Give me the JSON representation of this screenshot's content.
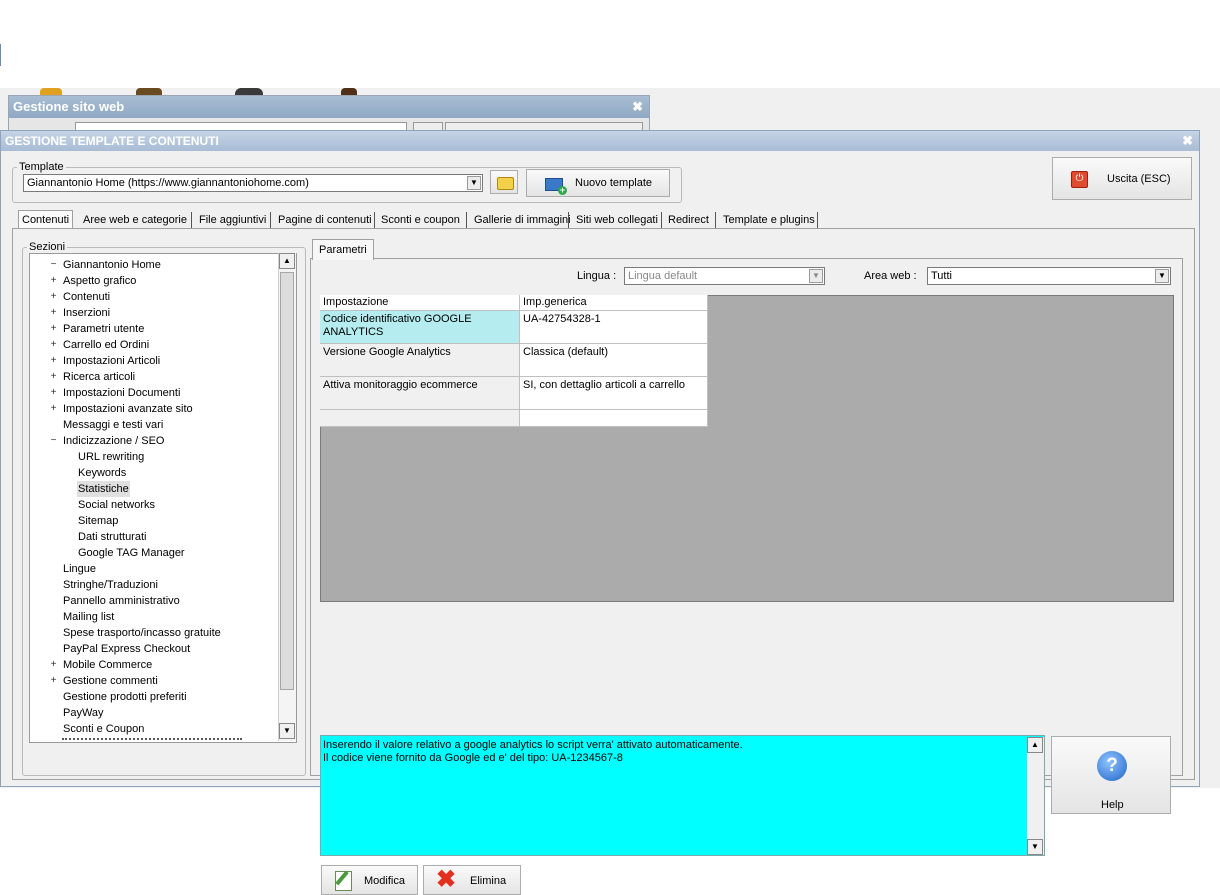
{
  "bg_window": {
    "title": "Gestione sito web",
    "close": "✖"
  },
  "main_window": {
    "title": "GESTIONE TEMPLATE E CONTENUTI",
    "close": "✖"
  },
  "template_group": {
    "legend": "Template",
    "selected": "Giannantonio Home (https://www.giannantoniohome.com)",
    "new_button": "Nuovo template"
  },
  "exit_button": "Uscita (ESC)",
  "tabs": [
    {
      "label": "Contenuti"
    },
    {
      "label": "Aree web e categorie"
    },
    {
      "label": "File aggiuntivi"
    },
    {
      "label": "Pagine di contenuti"
    },
    {
      "label": "Sconti e coupon"
    },
    {
      "label": "Gallerie di immagini"
    },
    {
      "label": "Siti web collegati"
    },
    {
      "label": "Redirect"
    },
    {
      "label": "Template e plugins"
    }
  ],
  "sections": {
    "legend": "Sezioni",
    "items": [
      {
        "label": "Giannantonio Home",
        "expander": "−"
      },
      {
        "label": "Aspetto grafico",
        "expander": "+"
      },
      {
        "label": "Contenuti",
        "expander": "+"
      },
      {
        "label": "Inserzioni",
        "expander": "+"
      },
      {
        "label": "Parametri utente",
        "expander": "+"
      },
      {
        "label": "Carrello ed Ordini",
        "expander": "+"
      },
      {
        "label": "Impostazioni Articoli",
        "expander": "+"
      },
      {
        "label": "Ricerca articoli",
        "expander": "+"
      },
      {
        "label": "Impostazioni Documenti",
        "expander": "+"
      },
      {
        "label": "Impostazioni avanzate sito",
        "expander": "+"
      },
      {
        "label": "Messaggi e testi vari",
        "expander": ""
      },
      {
        "label": "Indicizzazione / SEO",
        "expander": "−"
      },
      {
        "label": "URL rewriting",
        "expander": ""
      },
      {
        "label": "Keywords",
        "expander": ""
      },
      {
        "label": "Statistiche",
        "expander": ""
      },
      {
        "label": "Social networks",
        "expander": ""
      },
      {
        "label": "Sitemap",
        "expander": ""
      },
      {
        "label": "Dati strutturati",
        "expander": ""
      },
      {
        "label": "Google TAG Manager",
        "expander": ""
      },
      {
        "label": "Lingue",
        "expander": ""
      },
      {
        "label": "Stringhe/Traduzioni",
        "expander": ""
      },
      {
        "label": "Pannello amministrativo",
        "expander": ""
      },
      {
        "label": "Mailing list",
        "expander": ""
      },
      {
        "label": "Spese trasporto/incasso gratuite",
        "expander": ""
      },
      {
        "label": "PayPal Express Checkout",
        "expander": ""
      },
      {
        "label": "Mobile Commerce",
        "expander": "+"
      },
      {
        "label": "Gestione commenti",
        "expander": "+"
      },
      {
        "label": "Gestione prodotti preferiti",
        "expander": ""
      },
      {
        "label": "PayWay",
        "expander": ""
      },
      {
        "label": "Sconti e Coupon",
        "expander": ""
      }
    ]
  },
  "params": {
    "tab": "Parametri",
    "lingua_label": "Lingua :",
    "lingua_value": "Lingua default",
    "area_label": "Area web :",
    "area_value": "Tutti"
  },
  "grid": {
    "headers": [
      "Impostazione",
      "Imp.generica"
    ],
    "rows": [
      {
        "setting": "Codice identificativo GOOGLE ANALYTICS",
        "value": "UA-42754328-1"
      },
      {
        "setting": "Versione Google Analytics",
        "value": "Classica (default)"
      },
      {
        "setting": "Attiva monitoraggio ecommerce",
        "value": "SI, con dettaglio articoli a carrello"
      },
      {
        "setting": "",
        "value": ""
      }
    ]
  },
  "description": {
    "line1": "Inserendo il valore relativo a google analytics lo script verra' attivato automaticamente.",
    "line2": "Il codice viene fornito da Google ed e' del tipo: UA-1234567-8"
  },
  "help_button": "Help",
  "buttons": {
    "modifica": "Modifica",
    "elimina": "Elimina"
  },
  "colors": {
    "desc_bg": "#00ffff",
    "selected_cell": "#b4ecf0",
    "grid_bg": "#ababab"
  }
}
